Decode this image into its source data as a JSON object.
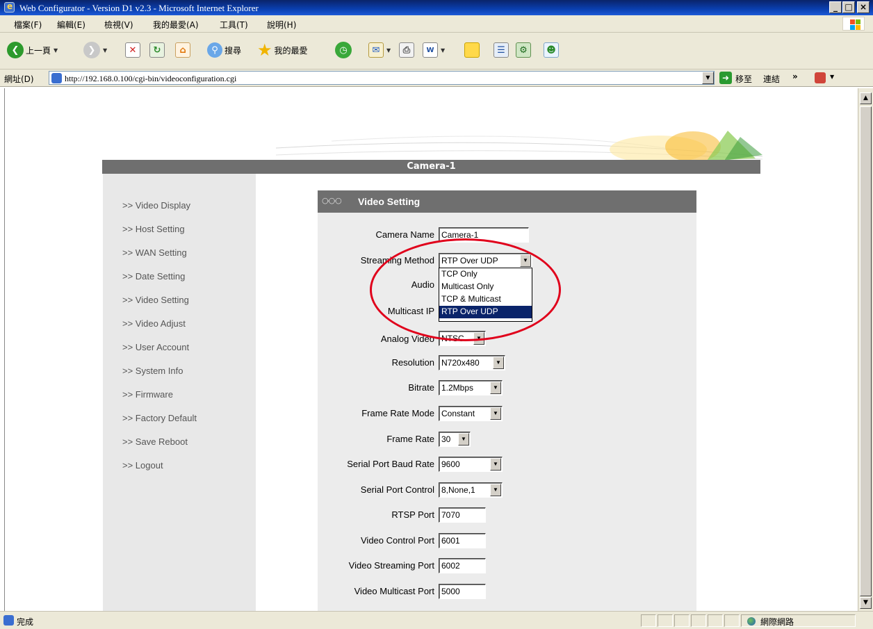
{
  "window": {
    "title": "Web Configurator - Version D1 v2.3 - Microsoft Internet Explorer",
    "controls": [
      "_",
      "□",
      "×"
    ]
  },
  "menu": [
    "檔案(F)",
    "編輯(E)",
    "檢視(V)",
    "我的最愛(A)",
    "工具(T)",
    "說明(H)"
  ],
  "toolbar": {
    "back_label": "上一頁",
    "search_label": "搜尋",
    "favorites_label": "我的最愛"
  },
  "address": {
    "label": "網址(D)",
    "url": "http://192.168.0.100/cgi-bin/videoconfiguration.cgi",
    "go_label": "移至",
    "links_label": "連結"
  },
  "page": {
    "header": "Camera-1",
    "nav": [
      ">> Video Display",
      ">> Host Setting",
      ">> WAN Setting",
      ">> Date Setting",
      ">> Video Setting",
      ">> Video Adjust",
      ">> User Account",
      ">> System Info",
      ">> Firmware",
      ">> Factory Default",
      ">> Save Reboot",
      ">> Logout"
    ],
    "panel_title": "Video Setting",
    "fields": {
      "camera_name": {
        "label": "Camera Name",
        "value": "Camera-1"
      },
      "streaming_method": {
        "label": "Streaming Method",
        "value": "RTP Over UDP"
      },
      "audio": {
        "label": "Audio"
      },
      "multicast_ip": {
        "label": "Multicast IP"
      },
      "analog_video": {
        "label": "Analog Video",
        "value": "NTSC"
      },
      "resolution": {
        "label": "Resolution",
        "value": "N720x480"
      },
      "bitrate": {
        "label": "Bitrate",
        "value": "1.2Mbps"
      },
      "frame_rate_mode": {
        "label": "Frame Rate Mode",
        "value": "Constant"
      },
      "frame_rate": {
        "label": "Frame Rate",
        "value": "30"
      },
      "baud_rate": {
        "label": "Serial Port Baud Rate",
        "value": "9600"
      },
      "serial_control": {
        "label": "Serial Port Control",
        "value": "8,None,1"
      },
      "rtsp_port": {
        "label": "RTSP Port",
        "value": "7070"
      },
      "video_control_port": {
        "label": "Video Control Port",
        "value": "6001"
      },
      "video_streaming_port": {
        "label": "Video Streaming Port",
        "value": "6002"
      },
      "video_multicast_port": {
        "label": "Video Multicast Port",
        "value": "5000"
      }
    },
    "streaming_options": [
      "TCP Only",
      "Multicast Only",
      "TCP & Multicast",
      "RTP Over UDP"
    ]
  },
  "status": {
    "text": "完成",
    "zone": "網際網路"
  },
  "colors": {
    "titlebar": "#0a246a",
    "header_bar": "#6f6f6f",
    "selected_option": "#0a246a",
    "highlight_oval": "#e0001b"
  }
}
